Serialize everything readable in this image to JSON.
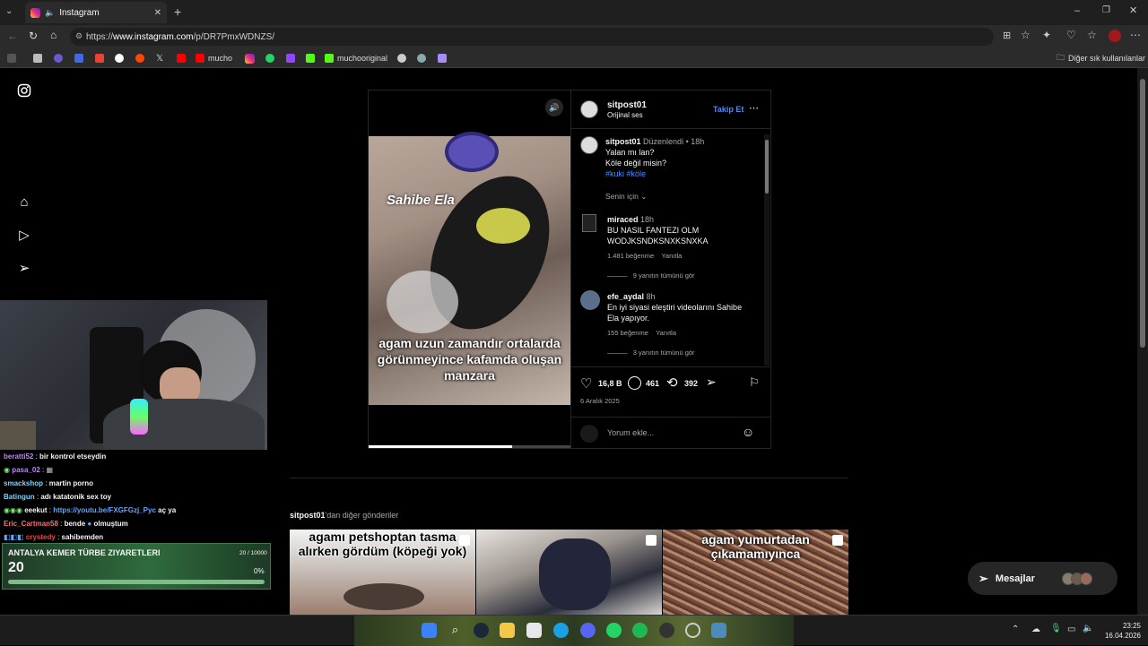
{
  "browser": {
    "tab_title": "Instagram",
    "url_prefix": "https://",
    "url_host": "www.instagram.com",
    "url_path": "/p/DR7PmxWDNZS/",
    "bookmarks": [
      "mucho",
      "muchooriginal"
    ],
    "other_bookmarks": "Diğer sık kullanılanlar"
  },
  "post": {
    "video_caption": "agam uzun zamandır ortalarda görünmeyince kafamda oluşan manzara",
    "video_overlay_text": "Sahibe Ela",
    "progress": 0.71,
    "author": "sitpost01",
    "audio": "Orijinal ses",
    "follow": "Takip Et",
    "caption_user": "sitpost01",
    "caption_edited": "Düzenlendi",
    "caption_time": "18h",
    "caption_line1": "Yalan mı lan?",
    "caption_line2": "Köle değil misin?",
    "caption_tags": "#kuki #köle",
    "sort": "Senin için",
    "comments": [
      {
        "user": "miraced",
        "time": "18h",
        "text": "BU NASIL FANTEZI OLM WODJKSNDKSNXKSNXKA",
        "likes": "1.481 beğenme",
        "reply": "Yanıtla",
        "view": "9 yanıtın tümünü gör"
      },
      {
        "user": "efe_aydal",
        "time": "8h",
        "text": "En iyi siyasi eleştiri videolarını Sahibe Ela yapıyor.",
        "likes": "155 beğenme",
        "reply": "Yanıtla",
        "view": "3 yanıtın tümünü gör"
      }
    ],
    "like_count": "16,8 B",
    "comment_count": "461",
    "repost_count": "392",
    "date": "6 Aralık 2025",
    "add_comment_placeholder": "Yorum ekle..."
  },
  "more_posts": {
    "user": "sitpost01",
    "label": "'dan diğer gönderiler",
    "thumbs": [
      {
        "caption": "agamı petshoptan tasma alırken gördüm (köpeği yok)"
      },
      {
        "caption": ""
      },
      {
        "caption": "agam yumurtadan çıkamamıyınca"
      }
    ]
  },
  "messages": {
    "label": "Mesajlar"
  },
  "stream": {
    "chat": [
      {
        "user": "beratti52",
        "color": "#c084fc",
        "text": "bir kontrol etseydin"
      },
      {
        "user": "pasa_02",
        "color": "#c084fc",
        "text": ""
      },
      {
        "user": "smackshop",
        "color": "#7dd3fc",
        "text": "martin porno"
      },
      {
        "user": "Batingun",
        "color": "#7dd3fc",
        "text": "adı katatonik sex toy"
      },
      {
        "user": "eeekut",
        "color": "#ffffff",
        "text": "https://youtu.be/FXGFGzj_Pyc",
        "suffix": "aç ya"
      },
      {
        "user": "Eric_Cartman58",
        "color": "#f87171",
        "text": "bende",
        "suffix": "olmuştum"
      },
      {
        "user": "crystedy",
        "color": "#ef4444",
        "text": "sahibemden"
      }
    ],
    "goal_title": "ANTALYA KEMER TÜRBE ZIYARETLERI",
    "goal_count": "20 / 10000",
    "goal_current": "20",
    "goal_percent": "0%"
  },
  "taskbar": {
    "time": "23:25",
    "date": "16.04.2026"
  }
}
